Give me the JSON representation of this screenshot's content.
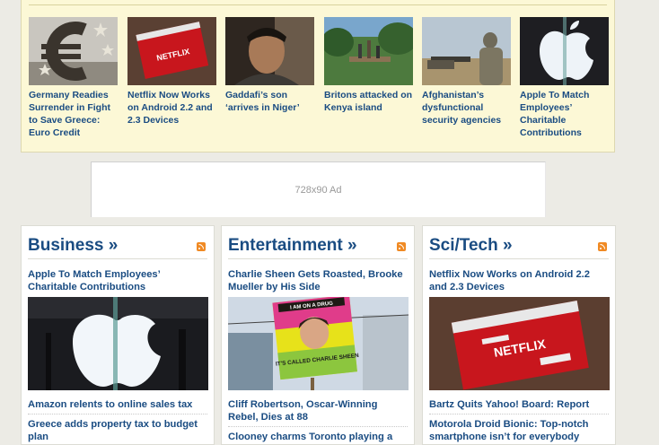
{
  "top_stories": [
    {
      "title": "Germany Readies Surrender in Fight to Save Greece: Euro Credit",
      "image": "euro-sculpture"
    },
    {
      "title": "Netflix Now Works on Android 2.2 and 2.3 Devices",
      "image": "netflix-envelope"
    },
    {
      "title": "Gaddafi’s son ‘arrives in Niger’",
      "image": "portrait"
    },
    {
      "title": "Britons attacked on Kenya island",
      "image": "jungle-bridge"
    },
    {
      "title": "Afghanistan’s dysfunctional security agencies",
      "image": "soldier"
    },
    {
      "title": "Apple To Match Employees’ Charitable Contributions",
      "image": "apple-logo"
    }
  ],
  "ad": {
    "label": "728x90 Ad"
  },
  "sections": [
    {
      "title": "Business »",
      "lead": "Apple To Match Employees’ Charitable Contributions",
      "image": "apple-logo",
      "items": [
        "Amazon relents to online sales tax",
        "Greece adds property tax to budget plan"
      ]
    },
    {
      "title": "Entertainment »",
      "lead": "Charlie Sheen Gets Roasted, Brooke Mueller by His Side",
      "image": "protest-sign",
      "sign_top": "I AM ON A DRUG",
      "sign_bottom": "IT'S CALLED CHARLIE SHEEN",
      "items": [
        "Cliff Robertson, Oscar-Winning Rebel, Dies at 88",
        "Clooney charms Toronto playing a"
      ]
    },
    {
      "title": "Sci/Tech »",
      "lead": "Netflix Now Works on Android 2.2 and 2.3 Devices",
      "image": "netflix-envelope",
      "items": [
        "Bartz Quits Yahoo! Board: Report",
        "Motorola Droid Bionic: Top-notch smartphone isn’t for everybody"
      ]
    }
  ],
  "netflix_logo": "NETFLIX",
  "colors": {
    "link": "#1a4c82",
    "strip_bg": "#fcf8d6",
    "page_bg": "#ecebe5",
    "rss": "#f08a24",
    "netflix_red": "#c8161d"
  }
}
